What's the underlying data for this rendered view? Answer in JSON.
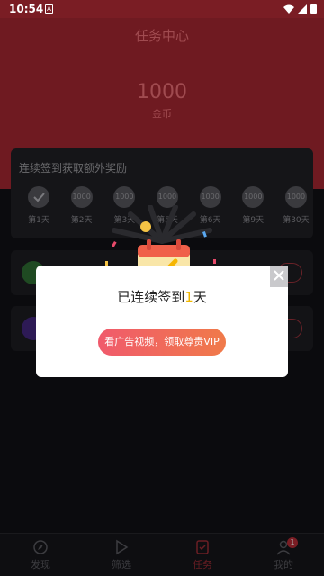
{
  "status_bar": {
    "time": "10:54",
    "app_badge": "A"
  },
  "header": {
    "title": "任务中心",
    "coins": "1000",
    "coins_label": "金币"
  },
  "checkin": {
    "title": "连续签到获取额外奖励",
    "days": [
      {
        "coin": "",
        "label": "第1天",
        "checked": true
      },
      {
        "coin": "1000",
        "label": "第2天"
      },
      {
        "coin": "1000",
        "label": "第3天"
      },
      {
        "coin": "1000",
        "label": "第5天"
      },
      {
        "coin": "1000",
        "label": "第6天"
      },
      {
        "coin": "1000",
        "label": "第9天"
      },
      {
        "coin": "1000",
        "label": "第30天"
      }
    ]
  },
  "modal": {
    "message_prefix": "已连续签到",
    "message_days": "1",
    "message_suffix": "天",
    "cta_label": "看广告视频，领取尊贵VIP"
  },
  "nav": {
    "items": [
      {
        "label": "发现",
        "icon": "compass-icon"
      },
      {
        "label": "筛选",
        "icon": "play-icon"
      },
      {
        "label": "任务",
        "icon": "task-icon",
        "active": true
      },
      {
        "label": "我的",
        "icon": "user-icon",
        "badge": "1"
      }
    ]
  },
  "colors": {
    "accent": "#f05a6c",
    "header_bg": "#6f1a21",
    "highlight": "#f1b700"
  }
}
